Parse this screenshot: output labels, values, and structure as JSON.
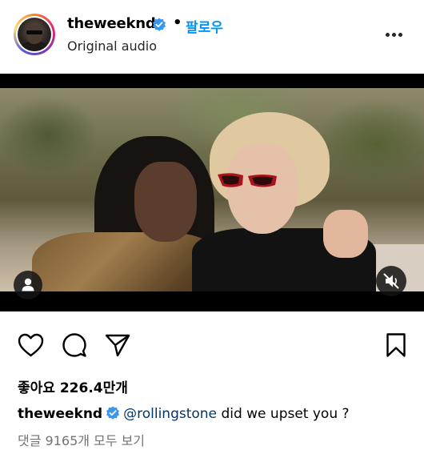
{
  "post": {
    "username": "theweeknd",
    "separator": "•",
    "follow_label": "팔로우",
    "audio_label": "Original audio",
    "likes_text": "좋아요 226.4만개",
    "caption": {
      "username": "theweeknd",
      "mention": "@rollingstone",
      "text": "did we upset you ?"
    },
    "comments_link": "댓글 9165개 모두 보기"
  },
  "icons": {
    "verified": "verified-badge-icon",
    "more": "more-options-icon",
    "person": "tagged-people-icon",
    "mute": "muted-speaker-icon",
    "like": "heart-icon",
    "comment": "comment-bubble-icon",
    "share": "paper-plane-icon",
    "save": "bookmark-icon"
  },
  "colors": {
    "accent": "#0095f6",
    "verified": "#3897f0",
    "mention": "#00376b",
    "secondary_text": "#737373"
  }
}
